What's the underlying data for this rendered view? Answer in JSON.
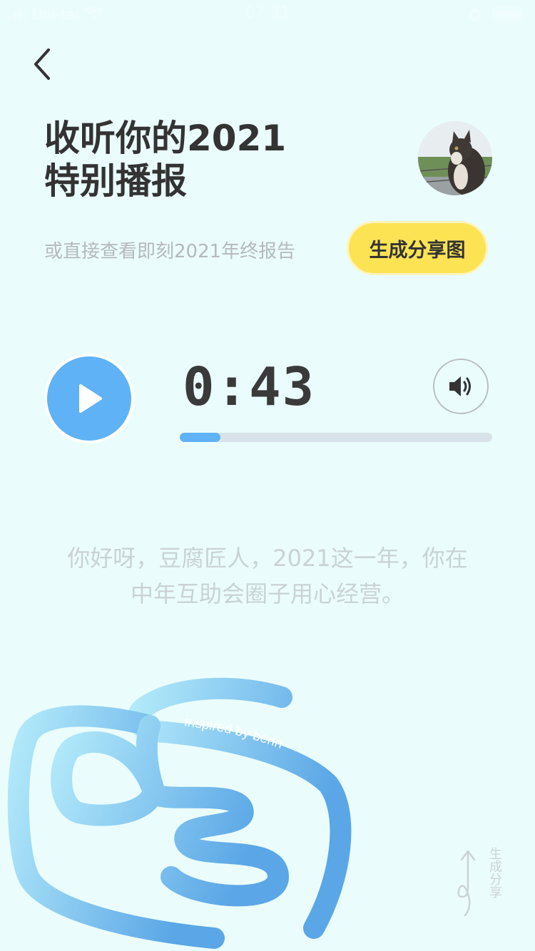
{
  "status_bar": {
    "carrier": "Uni-tel",
    "time": "07:31"
  },
  "header": {
    "title_line1": "收听你的2021",
    "title_line2": "特别播报"
  },
  "report": {
    "subtitle": "或直接查看即刻2021年终报告",
    "share_button_label": "生成分享图"
  },
  "player": {
    "time": "0:43",
    "progress": 0.13
  },
  "greeting": {
    "line1": "你好呀，豆腐匠人，2021这一年，你在",
    "line2": "中年互助会圈子用心经营。"
  },
  "artwork": {
    "caption": "inspired by benn"
  },
  "share_side_label": "生成分享",
  "colors": {
    "background": "#eafdfc",
    "accent_blue": "#5fb2f5",
    "accent_yellow": "#fce354",
    "text_dark": "#333333",
    "text_muted": "#b5b9bb"
  },
  "icons": {
    "back": "chevron-left-icon",
    "play": "play-icon",
    "volume": "volume-icon",
    "share": "arrow-up-icon"
  }
}
